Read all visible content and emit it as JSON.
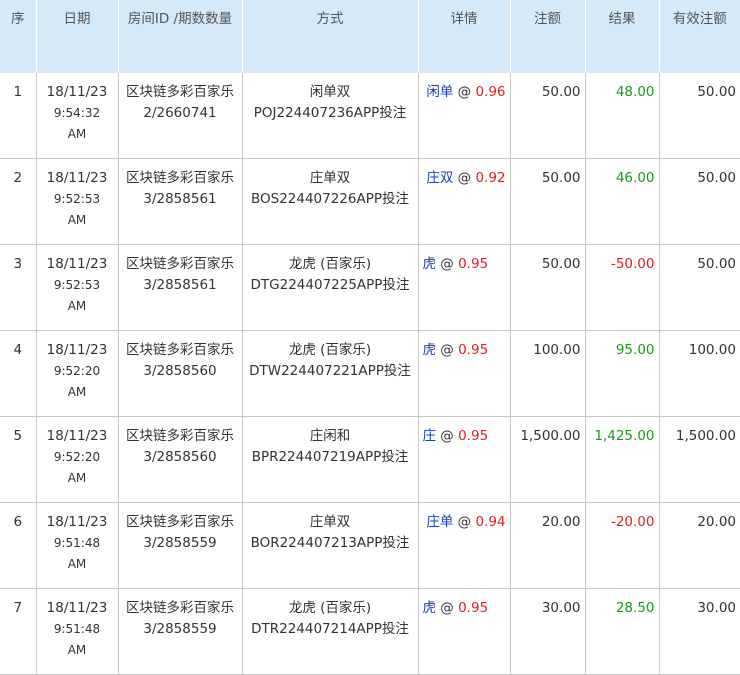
{
  "headers": {
    "seq": "序",
    "date": "日期",
    "room": "房间ID /期数数量",
    "method": "方式",
    "detail": "详情",
    "bet": "注额",
    "result": "结果",
    "valid": "有效注额"
  },
  "rows": [
    {
      "seq": "1",
      "date": "18/11/23",
      "time": "9:54:32",
      "ampm": "AM",
      "room": "区块链多彩百家乐",
      "period": "2/2660741",
      "method": "闲单双",
      "code": "POJ224407236APP投注",
      "bet_on": "闲单",
      "at": "@",
      "odds": "0.96",
      "bet": "50.00",
      "result": "48.00",
      "valid": "50.00"
    },
    {
      "seq": "2",
      "date": "18/11/23",
      "time": "9:52:53",
      "ampm": "AM",
      "room": "区块链多彩百家乐",
      "period": "3/2858561",
      "method": "庄单双",
      "code": "BOS224407226APP投注",
      "bet_on": "庄双",
      "at": "@",
      "odds": "0.92",
      "bet": "50.00",
      "result": "46.00",
      "valid": "50.00"
    },
    {
      "seq": "3",
      "date": "18/11/23",
      "time": "9:52:53",
      "ampm": "AM",
      "room": "区块链多彩百家乐",
      "period": "3/2858561",
      "method": "龙虎 (百家乐)",
      "code": "DTG224407225APP投注",
      "bet_on": "虎",
      "at": "@",
      "odds": "0.95",
      "bet": "50.00",
      "result": "-50.00",
      "valid": "50.00"
    },
    {
      "seq": "4",
      "date": "18/11/23",
      "time": "9:52:20",
      "ampm": "AM",
      "room": "区块链多彩百家乐",
      "period": "3/2858560",
      "method": "龙虎 (百家乐)",
      "code": "DTW224407221APP投注",
      "bet_on": "虎",
      "at": "@",
      "odds": "0.95",
      "bet": "100.00",
      "result": "95.00",
      "valid": "100.00"
    },
    {
      "seq": "5",
      "date": "18/11/23",
      "time": "9:52:20",
      "ampm": "AM",
      "room": "区块链多彩百家乐",
      "period": "3/2858560",
      "method": "庄闲和",
      "code": "BPR224407219APP投注",
      "bet_on": "庄",
      "at": "@",
      "odds": "0.95",
      "bet": "1,500.00",
      "result": "1,425.00",
      "valid": "1,500.00"
    },
    {
      "seq": "6",
      "date": "18/11/23",
      "time": "9:51:48",
      "ampm": "AM",
      "room": "区块链多彩百家乐",
      "period": "3/2858559",
      "method": "庄单双",
      "code": "BOR224407213APP投注",
      "bet_on": "庄单",
      "at": "@",
      "odds": "0.94",
      "bet": "20.00",
      "result": "-20.00",
      "valid": "20.00"
    },
    {
      "seq": "7",
      "date": "18/11/23",
      "time": "9:51:48",
      "ampm": "AM",
      "room": "区块链多彩百家乐",
      "period": "3/2858559",
      "method": "龙虎 (百家乐)",
      "code": "DTR224407214APP投注",
      "bet_on": "虎",
      "at": "@",
      "odds": "0.95",
      "bet": "30.00",
      "result": "28.50",
      "valid": "30.00"
    }
  ],
  "colors": {
    "header_bg": "#d6e9f8",
    "positive": "#1a9a1a",
    "negative": "#e02020",
    "selection": "#1a3ec0"
  }
}
